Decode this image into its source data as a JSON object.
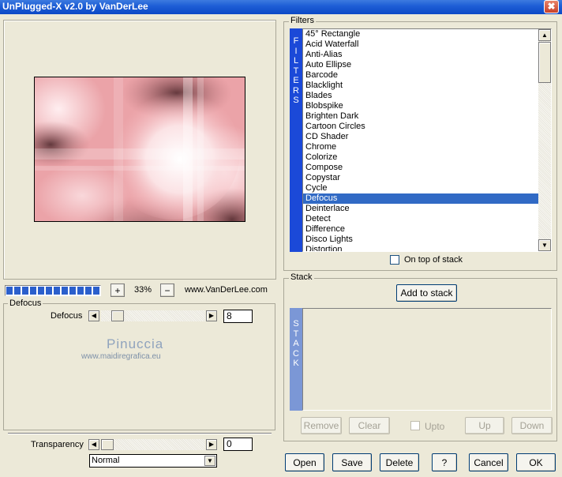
{
  "window": {
    "title": "UnPlugged-X v2.0 by VanDerLee",
    "close_icon": "✖"
  },
  "zoom": {
    "progress_segments": 12,
    "minus_label": "−",
    "plus_label": "+",
    "value": "33%"
  },
  "website": "www.VanDerLee.com",
  "defocus_group": {
    "label": "Defocus",
    "param_label": "Defocus",
    "param_value": "8",
    "slider_fraction": 0.06,
    "watermark": {
      "name": "Pinuccia",
      "url": "www.maidiregrafica.eu"
    }
  },
  "transparency": {
    "label": "Transparency",
    "value": "0",
    "slider_fraction": 0.0
  },
  "blend_mode": {
    "selected": "Normal"
  },
  "filters": {
    "label": "Filters",
    "tab_letters": [
      "F",
      "I",
      "L",
      "T",
      "E",
      "R",
      "S"
    ],
    "items": [
      "45° Rectangle",
      "Acid Waterfall",
      "Anti-Alias",
      "Auto Ellipse",
      "Barcode",
      "Blacklight",
      "Blades",
      "Blobspike",
      "Brighten Dark",
      "Cartoon Circles",
      "CD Shader",
      "Chrome",
      "Colorize",
      "Compose",
      "Copystar",
      "Cycle",
      "Defocus",
      "Deinterlace",
      "Detect",
      "Difference",
      "Disco Lights",
      "Distortion"
    ],
    "selected": "Defocus",
    "on_top_label": "On top of stack",
    "on_top_checked": false
  },
  "stack": {
    "label": "Stack",
    "add_label": "Add to stack",
    "tab_letters": [
      "S",
      "T",
      "A",
      "C",
      "K"
    ],
    "remove_label": "Remove",
    "clear_label": "Clear",
    "upto_label": "Upto",
    "up_label": "Up",
    "down_label": "Down"
  },
  "buttons": {
    "open": "Open",
    "save": "Save",
    "delete": "Delete",
    "help": "?",
    "cancel": "Cancel",
    "ok": "OK"
  },
  "colors": {
    "accent": "#316ac5",
    "tab_blue": "#1b49d8",
    "stack_tab": "#7b97d6"
  },
  "icons": {
    "scroll_up": "▲",
    "scroll_down": "▼",
    "slider_left": "◀",
    "slider_right": "▶",
    "dropdown": "▼"
  }
}
